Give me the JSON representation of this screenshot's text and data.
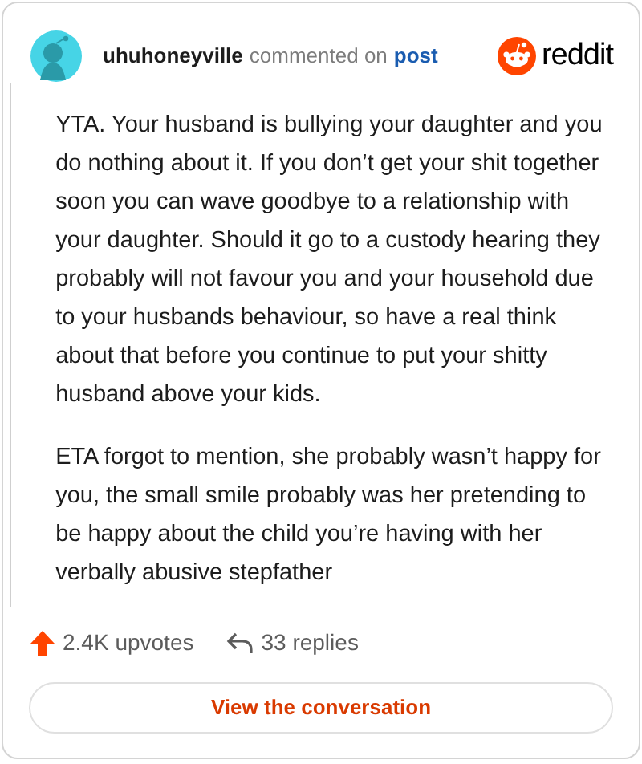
{
  "header": {
    "username": "uhuhoneyville",
    "action": "commented on",
    "link": "post",
    "logo_text": "reddit"
  },
  "comment": {
    "paragraphs": [
      "YTA. Your husband is bullying your daughter and you do nothing about it. If you don’t get your shit together soon you can wave goodbye to a relationship with your daughter. Should it go to a custody hearing they probably will not favour you and your household due to your husbands behaviour, so have a real think about that before you continue to put your shitty husband above your kids.",
      "ETA forgot to mention, she probably wasn’t happy for you, the small smile probably was her pretending to be happy about the child you’re having with her verbally abusive stepfather"
    ]
  },
  "footer": {
    "upvotes": "2.4K upvotes",
    "replies": "33 replies",
    "button": "View the conversation"
  }
}
